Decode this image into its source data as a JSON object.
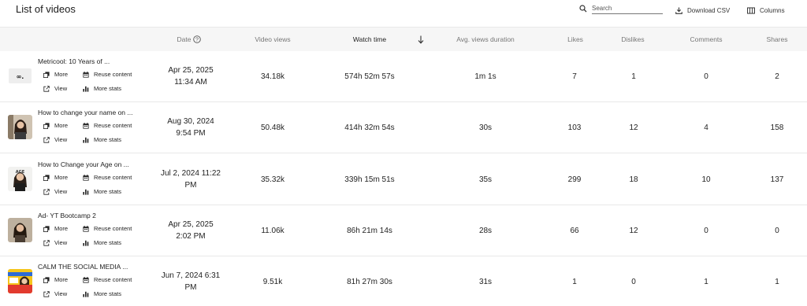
{
  "page": {
    "title": "List of videos"
  },
  "toolbar": {
    "search_placeholder": "Search",
    "download_label": "Download CSV",
    "columns_label": "Columns"
  },
  "columns": {
    "date": "Date",
    "video_views": "Video views",
    "watch_time": "Watch time",
    "avg_view_duration": "Avg. views duration",
    "likes": "Likes",
    "dislikes": "Dislikes",
    "comments": "Comments",
    "shares": "Shares"
  },
  "actions": {
    "more": "More",
    "reuse": "Reuse content",
    "view": "View",
    "more_stats": "More stats"
  },
  "rows": [
    {
      "title": "Metricool: 10 Years of ...",
      "date_line1": "Apr 25, 2025",
      "date_line2": "11:34 AM",
      "views": "34.18k",
      "watch_time": "574h 52m 57s",
      "avg_duration": "1m 1s",
      "likes": "7",
      "dislikes": "1",
      "comments": "0",
      "shares": "2"
    },
    {
      "title": "How to change your name on ...",
      "date_line1": "Aug 30, 2024",
      "date_line2": "9:54 PM",
      "views": "50.48k",
      "watch_time": "414h 32m 54s",
      "avg_duration": "30s",
      "likes": "103",
      "dislikes": "12",
      "comments": "4",
      "shares": "158"
    },
    {
      "title": "How to Change your Age on ...",
      "date_line1": "Jul 2, 2024 11:22",
      "date_line2": "PM",
      "views": "35.32k",
      "watch_time": "339h 15m 51s",
      "avg_duration": "35s",
      "likes": "299",
      "dislikes": "18",
      "comments": "10",
      "shares": "137"
    },
    {
      "title": "Ad- YT Bootcamp 2",
      "date_line1": "Apr 25, 2025",
      "date_line2": "2:02 PM",
      "views": "11.06k",
      "watch_time": "86h 21m 14s",
      "avg_duration": "28s",
      "likes": "66",
      "dislikes": "12",
      "comments": "0",
      "shares": "0"
    },
    {
      "title": "CALM THE SOCIAL MEDIA ...",
      "date_line1": "Jun 7, 2024 6:31",
      "date_line2": "PM",
      "views": "9.51k",
      "watch_time": "81h 27m 30s",
      "avg_duration": "31s",
      "likes": "1",
      "dislikes": "0",
      "comments": "1",
      "shares": "1"
    }
  ]
}
